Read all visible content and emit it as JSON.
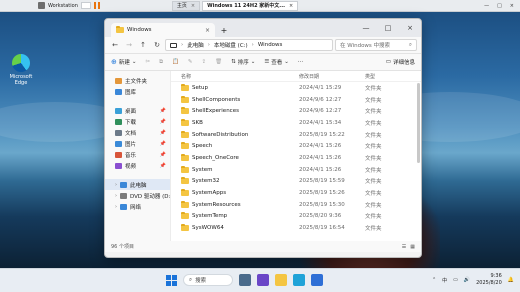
{
  "vmware": {
    "app_label": "Workstation",
    "tabs": [
      {
        "label": "主页",
        "active": false
      },
      {
        "label": "Windows 11 24H2 家新中文...",
        "active": true
      }
    ]
  },
  "desktop": {
    "icons": [
      {
        "label": "Microsoft Edge",
        "icon": "edge-icon"
      }
    ]
  },
  "explorer": {
    "tab_title": "Windows",
    "breadcrumb": [
      "此电脑",
      "本地磁盘 (C:)",
      "Windows"
    ],
    "search_placeholder": "在 Windows 中搜索",
    "toolbar": {
      "new_label": "新建",
      "sort_label": "排序",
      "view_label": "查看",
      "details_label": "详细信息"
    },
    "sidebar": [
      {
        "label": "主文件夹",
        "icon": "home-icon",
        "color": "#e4973a"
      },
      {
        "label": "图库",
        "icon": "gallery-icon",
        "color": "#3a87d8"
      },
      {
        "label": "桌面",
        "icon": "desktop-icon",
        "color": "#3aa0d8",
        "pinned": true
      },
      {
        "label": "下载",
        "icon": "download-icon",
        "color": "#2f8f5b",
        "pinned": true
      },
      {
        "label": "文档",
        "icon": "document-icon",
        "color": "#6c7a89",
        "pinned": true
      },
      {
        "label": "图片",
        "icon": "pictures-icon",
        "color": "#3a8ad8",
        "pinned": true
      },
      {
        "label": "音乐",
        "icon": "music-icon",
        "color": "#d8553a",
        "pinned": true
      },
      {
        "label": "视频",
        "icon": "video-icon",
        "color": "#8a4fd0",
        "pinned": true
      },
      {
        "label": "此电脑",
        "icon": "computer-icon",
        "color": "#3a87d8",
        "selected": true
      },
      {
        "label": "DVD 驱动器 (D:",
        "icon": "dvd-icon",
        "color": "#7b7b7b"
      },
      {
        "label": "网络",
        "icon": "network-icon",
        "color": "#3a87d8"
      }
    ],
    "columns": {
      "name": "名称",
      "date": "修改日期",
      "type": "类型"
    },
    "files": [
      {
        "name": "Setup",
        "date": "2024/4/1 15:29",
        "type": "文件夹"
      },
      {
        "name": "ShellComponents",
        "date": "2024/9/6 12:27",
        "type": "文件夹"
      },
      {
        "name": "ShellExperiences",
        "date": "2024/9/6 12:27",
        "type": "文件夹"
      },
      {
        "name": "SKB",
        "date": "2024/4/1 15:34",
        "type": "文件夹"
      },
      {
        "name": "SoftwareDistribution",
        "date": "2025/8/19 15:22",
        "type": "文件夹"
      },
      {
        "name": "Speech",
        "date": "2024/4/1 15:26",
        "type": "文件夹"
      },
      {
        "name": "Speech_OneCore",
        "date": "2024/4/1 15:26",
        "type": "文件夹"
      },
      {
        "name": "System",
        "date": "2024/4/1 15:26",
        "type": "文件夹"
      },
      {
        "name": "System32",
        "date": "2025/8/19 15:59",
        "type": "文件夹"
      },
      {
        "name": "SystemApps",
        "date": "2025/8/19 15:26",
        "type": "文件夹"
      },
      {
        "name": "SystemResources",
        "date": "2025/8/19 15:30",
        "type": "文件夹"
      },
      {
        "name": "SystemTemp",
        "date": "2025/8/20 9:36",
        "type": "文件夹"
      },
      {
        "name": "SysWOW64",
        "date": "2025/8/19 16:54",
        "type": "文件夹"
      }
    ],
    "status_text": "96 个项目"
  },
  "taskbar": {
    "search_label": "搜索",
    "time": "9:36",
    "date": "2025/8/20",
    "ime": "中"
  }
}
